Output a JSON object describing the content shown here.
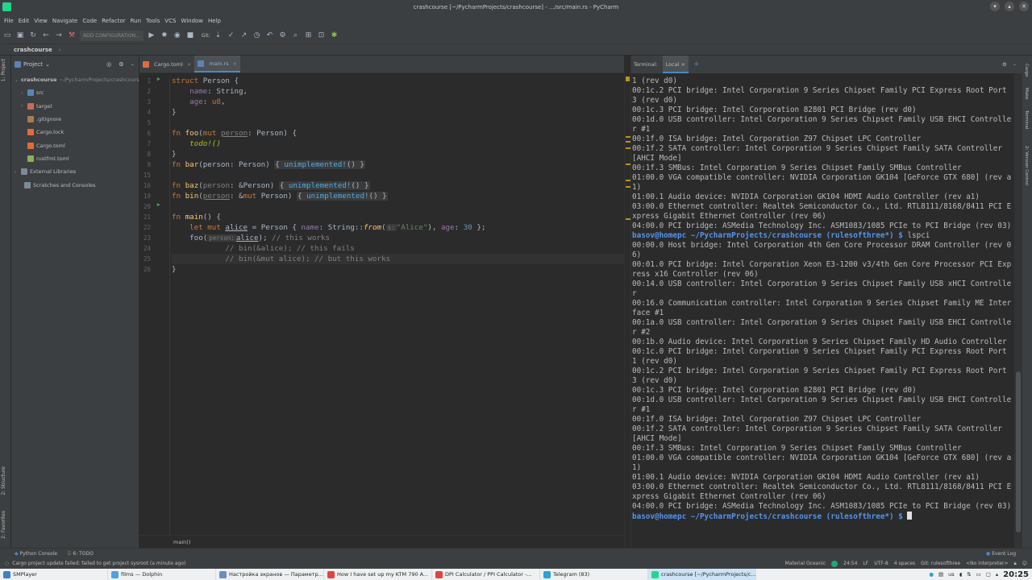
{
  "window": {
    "title": "crashcourse [~/PycharmProjects/crashcourse] - .../src/main.rs - PyCharm"
  },
  "menu": [
    "File",
    "Edit",
    "View",
    "Navigate",
    "Code",
    "Refactor",
    "Run",
    "Tools",
    "VCS",
    "Window",
    "Help"
  ],
  "toolbar": {
    "run_config": "ADD CONFIGURATION...",
    "git_label": "Git:"
  },
  "navbar": {
    "project": "crashcourse"
  },
  "left_tabs": [
    "1: Project",
    "2: Structure",
    "2: Favorites"
  ],
  "project_panel": {
    "title": "Project",
    "tree": [
      {
        "label": "crashcourse",
        "extra": "~/PycharmProjects/crashcourse",
        "kind": "folder-root"
      },
      {
        "label": "src",
        "kind": "folder-src"
      },
      {
        "label": "target",
        "kind": "folder-target"
      },
      {
        "label": ".gitignore",
        "kind": "file-git"
      },
      {
        "label": "Cargo.lock",
        "kind": "file-cargo"
      },
      {
        "label": "Cargo.toml",
        "kind": "file-cargo"
      },
      {
        "label": "rustfmt.toml",
        "kind": "file-toml"
      },
      {
        "label": "External Libraries",
        "kind": "lib"
      },
      {
        "label": "Scratches and Consoles",
        "kind": "scratch"
      }
    ]
  },
  "editor": {
    "tabs": [
      {
        "label": "Cargo.toml",
        "active": false
      },
      {
        "label": "main.rs",
        "active": true
      }
    ],
    "line_numbers": [
      "1",
      "2",
      "3",
      "4",
      "5",
      "6",
      "7",
      "8",
      "9",
      "15",
      "16",
      "19",
      "20",
      "21",
      "22",
      "23",
      "24",
      "25",
      "26"
    ],
    "breadcrumb": "main()"
  },
  "terminal": {
    "label": "Terminal:",
    "tab": "Local",
    "add": "+",
    "prompt_user": "basov@homepc",
    "prompt_path": " ~/PycharmProjects/crashcourse (rulesofthree*) $ ",
    "command": "lspci",
    "output_before": "1 (rev d0)\n00:1c.2 PCI bridge: Intel Corporation 9 Series Chipset Family PCI Express Root Port 3 (rev d0)\n00:1c.3 PCI bridge: Intel Corporation 82801 PCI Bridge (rev d0)\n00:1d.0 USB controller: Intel Corporation 9 Series Chipset Family USB EHCI Controller #1\n00:1f.0 ISA bridge: Intel Corporation Z97 Chipset LPC Controller\n00:1f.2 SATA controller: Intel Corporation 9 Series Chipset Family SATA Controller [AHCI Mode]\n00:1f.3 SMBus: Intel Corporation 9 Series Chipset Family SMBus Controller\n01:00.0 VGA compatible controller: NVIDIA Corporation GK104 [GeForce GTX 680] (rev a1)\n01:00.1 Audio device: NVIDIA Corporation GK104 HDMI Audio Controller (rev a1)\n03:00.0 Ethernet controller: Realtek Semiconductor Co., Ltd. RTL8111/8168/8411 PCI Express Gigabit Ethernet Controller (rev 06)\n04:00.0 PCI bridge: ASMedia Technology Inc. ASM1083/1085 PCIe to PCI Bridge (rev 03)",
    "output_after": "00:00.0 Host bridge: Intel Corporation 4th Gen Core Processor DRAM Controller (rev 06)\n00:01.0 PCI bridge: Intel Corporation Xeon E3-1200 v3/4th Gen Core Processor PCI Express x16 Controller (rev 06)\n00:14.0 USB controller: Intel Corporation 9 Series Chipset Family USB xHCI Controller\n00:16.0 Communication controller: Intel Corporation 9 Series Chipset Family ME Interface #1\n00:1a.0 USB controller: Intel Corporation 9 Series Chipset Family USB EHCI Controller #2\n00:1b.0 Audio device: Intel Corporation 9 Series Chipset Family HD Audio Controller\n00:1c.0 PCI bridge: Intel Corporation 9 Series Chipset Family PCI Express Root Port 1 (rev d0)\n00:1c.2 PCI bridge: Intel Corporation 9 Series Chipset Family PCI Express Root Port 3 (rev d0)\n00:1c.3 PCI bridge: Intel Corporation 82801 PCI Bridge (rev d0)\n00:1d.0 USB controller: Intel Corporation 9 Series Chipset Family USB EHCI Controller #1\n00:1f.0 ISA bridge: Intel Corporation Z97 Chipset LPC Controller\n00:1f.2 SATA controller: Intel Corporation 9 Series Chipset Family SATA Controller [AHCI Mode]\n00:1f.3 SMBus: Intel Corporation 9 Series Chipset Family SMBus Controller\n01:00.0 VGA compatible controller: NVIDIA Corporation GK104 [GeForce GTX 680] (rev a1)\n01:00.1 Audio device: NVIDIA Corporation GK104 HDMI Audio Controller (rev a1)\n03:00.0 Ethernet controller: Realtek Semiconductor Co., Ltd. RTL8111/8168/8411 PCI Express Gigabit Ethernet Controller (rev 06)\n04:00.0 PCI bridge: ASMedia Technology Inc. ASM1083/1085 PCIe to PCI Bridge (rev 03)"
  },
  "right_tabs": [
    "Cargo",
    "Make",
    "Terminal",
    "2: Version Control"
  ],
  "toolwin_bar": {
    "python_console": "Python Console",
    "todo": "6: TODO",
    "event_log": "Event Log"
  },
  "statusbar": {
    "message": "Cargo project update failed: failed to get project sysroot (a minute ago)",
    "theme": "Material Oceanic",
    "position": "24:54",
    "line_sep": "LF",
    "encoding": "UTF-8",
    "indent": "4 spaces",
    "git": "Git: rulesofthree",
    "interpreter": "<No interpreter>"
  },
  "taskbar": {
    "tasks": [
      {
        "label": "SMPlayer",
        "color": "#3d7fc9"
      },
      {
        "label": "films — Dolphin",
        "color": "#4aa3df"
      },
      {
        "label": "Настройка экранов — Параметр...",
        "color": "#6b8dc7"
      },
      {
        "label": "How I have set up my KTM 790 A...",
        "color": "#e0443e"
      },
      {
        "label": "DPI Calculator / PPI Calculator -...",
        "color": "#e0443e"
      },
      {
        "label": "Telegram (83)",
        "color": "#2aa1da"
      },
      {
        "label": "crashcourse [~/PycharmProjects/c...",
        "color": "#21d789"
      }
    ],
    "keyboard": "us",
    "clock": "20:25"
  },
  "colors": {
    "accent": "#4a88c7",
    "panel": "#3c3f41",
    "editor_bg": "#2b2b2b"
  }
}
